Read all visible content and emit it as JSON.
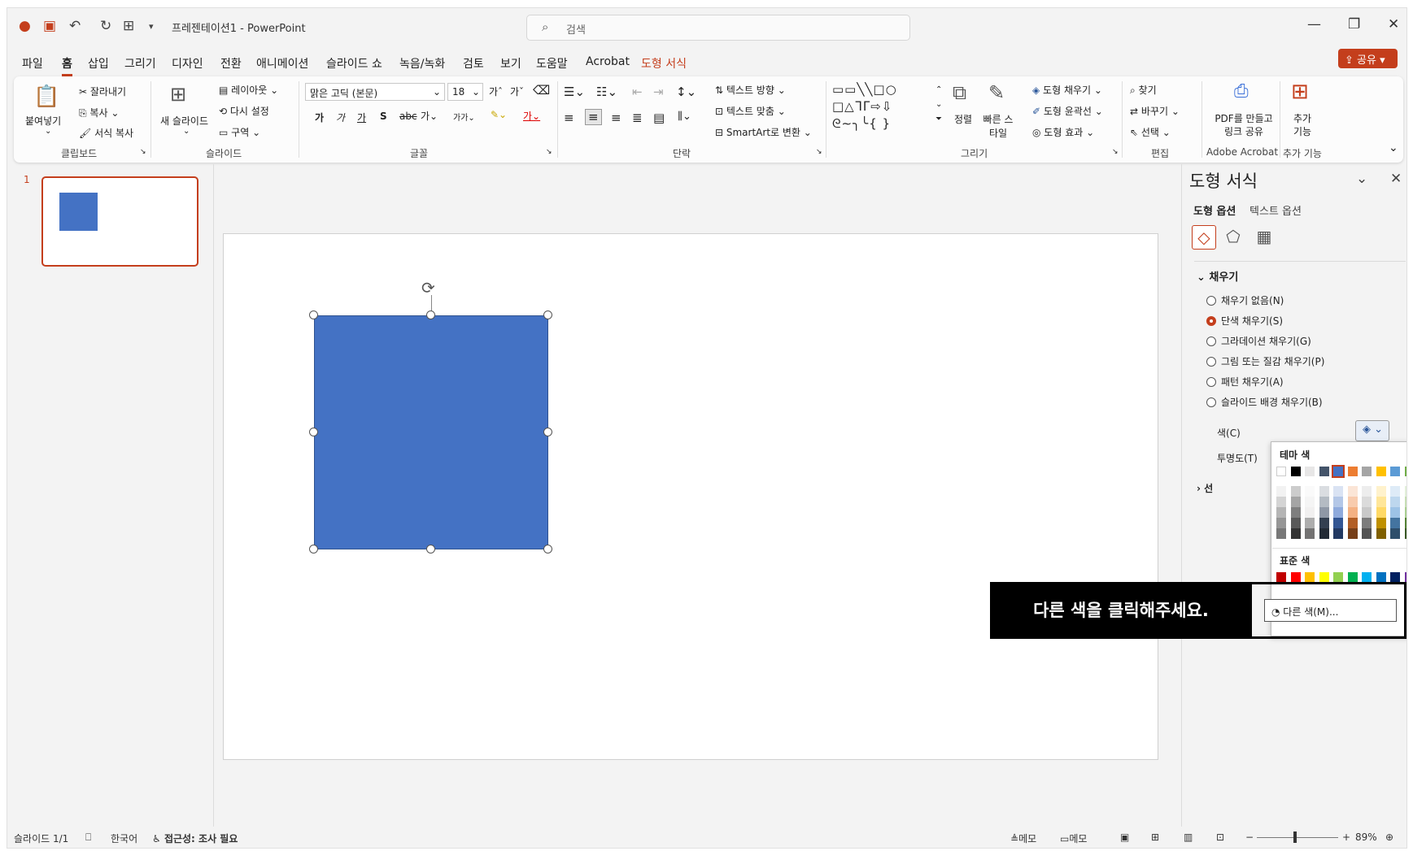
{
  "app": {
    "title": "프레젠테이션1 - PowerPoint",
    "search_placeholder": "검색"
  },
  "menu": {
    "items": [
      "파일",
      "홈",
      "삽입",
      "그리기",
      "디자인",
      "전환",
      "애니메이션",
      "슬라이드 쇼",
      "녹음/녹화",
      "검토",
      "보기",
      "도움말",
      "Acrobat",
      "도형 서식"
    ],
    "share": "공유"
  },
  "ribbon": {
    "clipboard": {
      "paste": "붙여넣기",
      "cut": "잘라내기",
      "copy": "복사",
      "format_painter": "서식 복사",
      "label": "클립보드"
    },
    "slides": {
      "new_slide": "새 슬라이드",
      "layout": "레이아웃",
      "reset": "다시 설정",
      "section": "구역",
      "label": "슬라이드"
    },
    "font": {
      "family": "맑은 고딕 (본문)",
      "size": "18",
      "label": "글꼴"
    },
    "paragraph": {
      "text_direction": "텍스트 방향",
      "align_text": "텍스트 맞춤",
      "smartart": "SmartArt로 변환",
      "label": "단락"
    },
    "drawing": {
      "arrange": "정렬",
      "quick_styles": "빠른 스타일",
      "shape_fill": "도형 채우기",
      "shape_outline": "도형 윤곽선",
      "shape_effects": "도형 효과",
      "label": "그리기"
    },
    "editing": {
      "find": "찾기",
      "replace": "바꾸기",
      "select": "선택",
      "label": "편집"
    },
    "acrobat": {
      "pdf_share": "PDF를 만들고 링크 공유",
      "label": "Adobe Acrobat"
    },
    "addins": {
      "button": "추가 기능",
      "label": "추가 기능"
    }
  },
  "slides_panel": {
    "number": "1"
  },
  "format_pane": {
    "title": "도형 서식",
    "tabs": [
      "도형 옵션",
      "텍스트 옵션"
    ],
    "section": "채우기",
    "fill_options": [
      {
        "label": "채우기 없음(N)",
        "selected": false
      },
      {
        "label": "단색 채우기(S)",
        "selected": true
      },
      {
        "label": "그라데이션 채우기(G)",
        "selected": false
      },
      {
        "label": "그림 또는 질감 채우기(P)",
        "selected": false
      },
      {
        "label": "패턴 채우기(A)",
        "selected": false
      },
      {
        "label": "슬라이드 배경 채우기(B)",
        "selected": false
      }
    ],
    "color_label": "색(C)",
    "transparency_label": "투명도(T)",
    "line_section": "선"
  },
  "palette": {
    "theme_label": "테마 색",
    "standard_label": "표준 색",
    "more_colors": "다른 색(M)...",
    "theme_colors": [
      "#ffffff",
      "#000000",
      "#e7e6e6",
      "#44546a",
      "#4472c4",
      "#ed7d31",
      "#a5a5a5",
      "#ffc000",
      "#5b9bd5",
      "#70ad47"
    ],
    "standard_colors": [
      "#c00000",
      "#ff0000",
      "#ffc000",
      "#ffff00",
      "#92d050",
      "#00b050",
      "#00b0f0",
      "#0070c0",
      "#002060",
      "#7030a0"
    ]
  },
  "tooltip": {
    "text": "다른 색을 클릭해주세요."
  },
  "status": {
    "slide": "슬라이드 1/1",
    "language": "한국어",
    "accessibility": "접근성: 조사 필요",
    "notes": "메모",
    "comments": "메모",
    "zoom": "89%"
  },
  "colors": {
    "accent": "#c43e1c",
    "shape_fill": "#4472c4"
  }
}
